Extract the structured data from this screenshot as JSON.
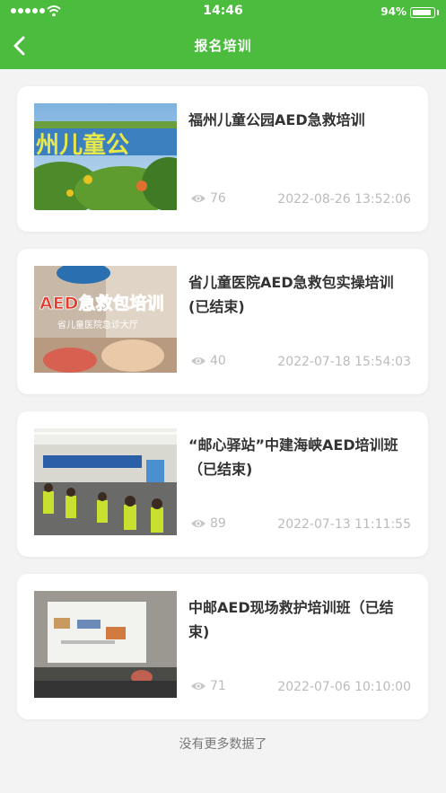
{
  "status_bar": {
    "time": "14:46",
    "battery_text": "94%"
  },
  "nav": {
    "title": "报名培训",
    "back_icon": "chevron-left-icon"
  },
  "colors": {
    "header_bg": "#4cbc3f",
    "page_bg": "#f3f3f3",
    "meta_text": "#bbbbbb"
  },
  "cards": [
    {
      "title": "福州儿童公园AED急救培训",
      "views": "76",
      "date": "2022-08-26 13:52:06",
      "thumb_caption": "州儿童公"
    },
    {
      "title": "省儿童医院AED急救包实操培训(已结束)",
      "views": "40",
      "date": "2022-07-18 15:54:03",
      "thumb_caption": "AED急救包培训",
      "thumb_subcaption": "省儿童医院急诊大厅"
    },
    {
      "title": "“邮心驿站”中建海峡AED培训班（已结束)",
      "views": "89",
      "date": "2022-07-13 11:11:55"
    },
    {
      "title": "中邮AED现场救护培训班（已结束)",
      "views": "71",
      "date": "2022-07-06 10:10:00"
    }
  ],
  "footer": {
    "text": "没有更多数据了"
  }
}
